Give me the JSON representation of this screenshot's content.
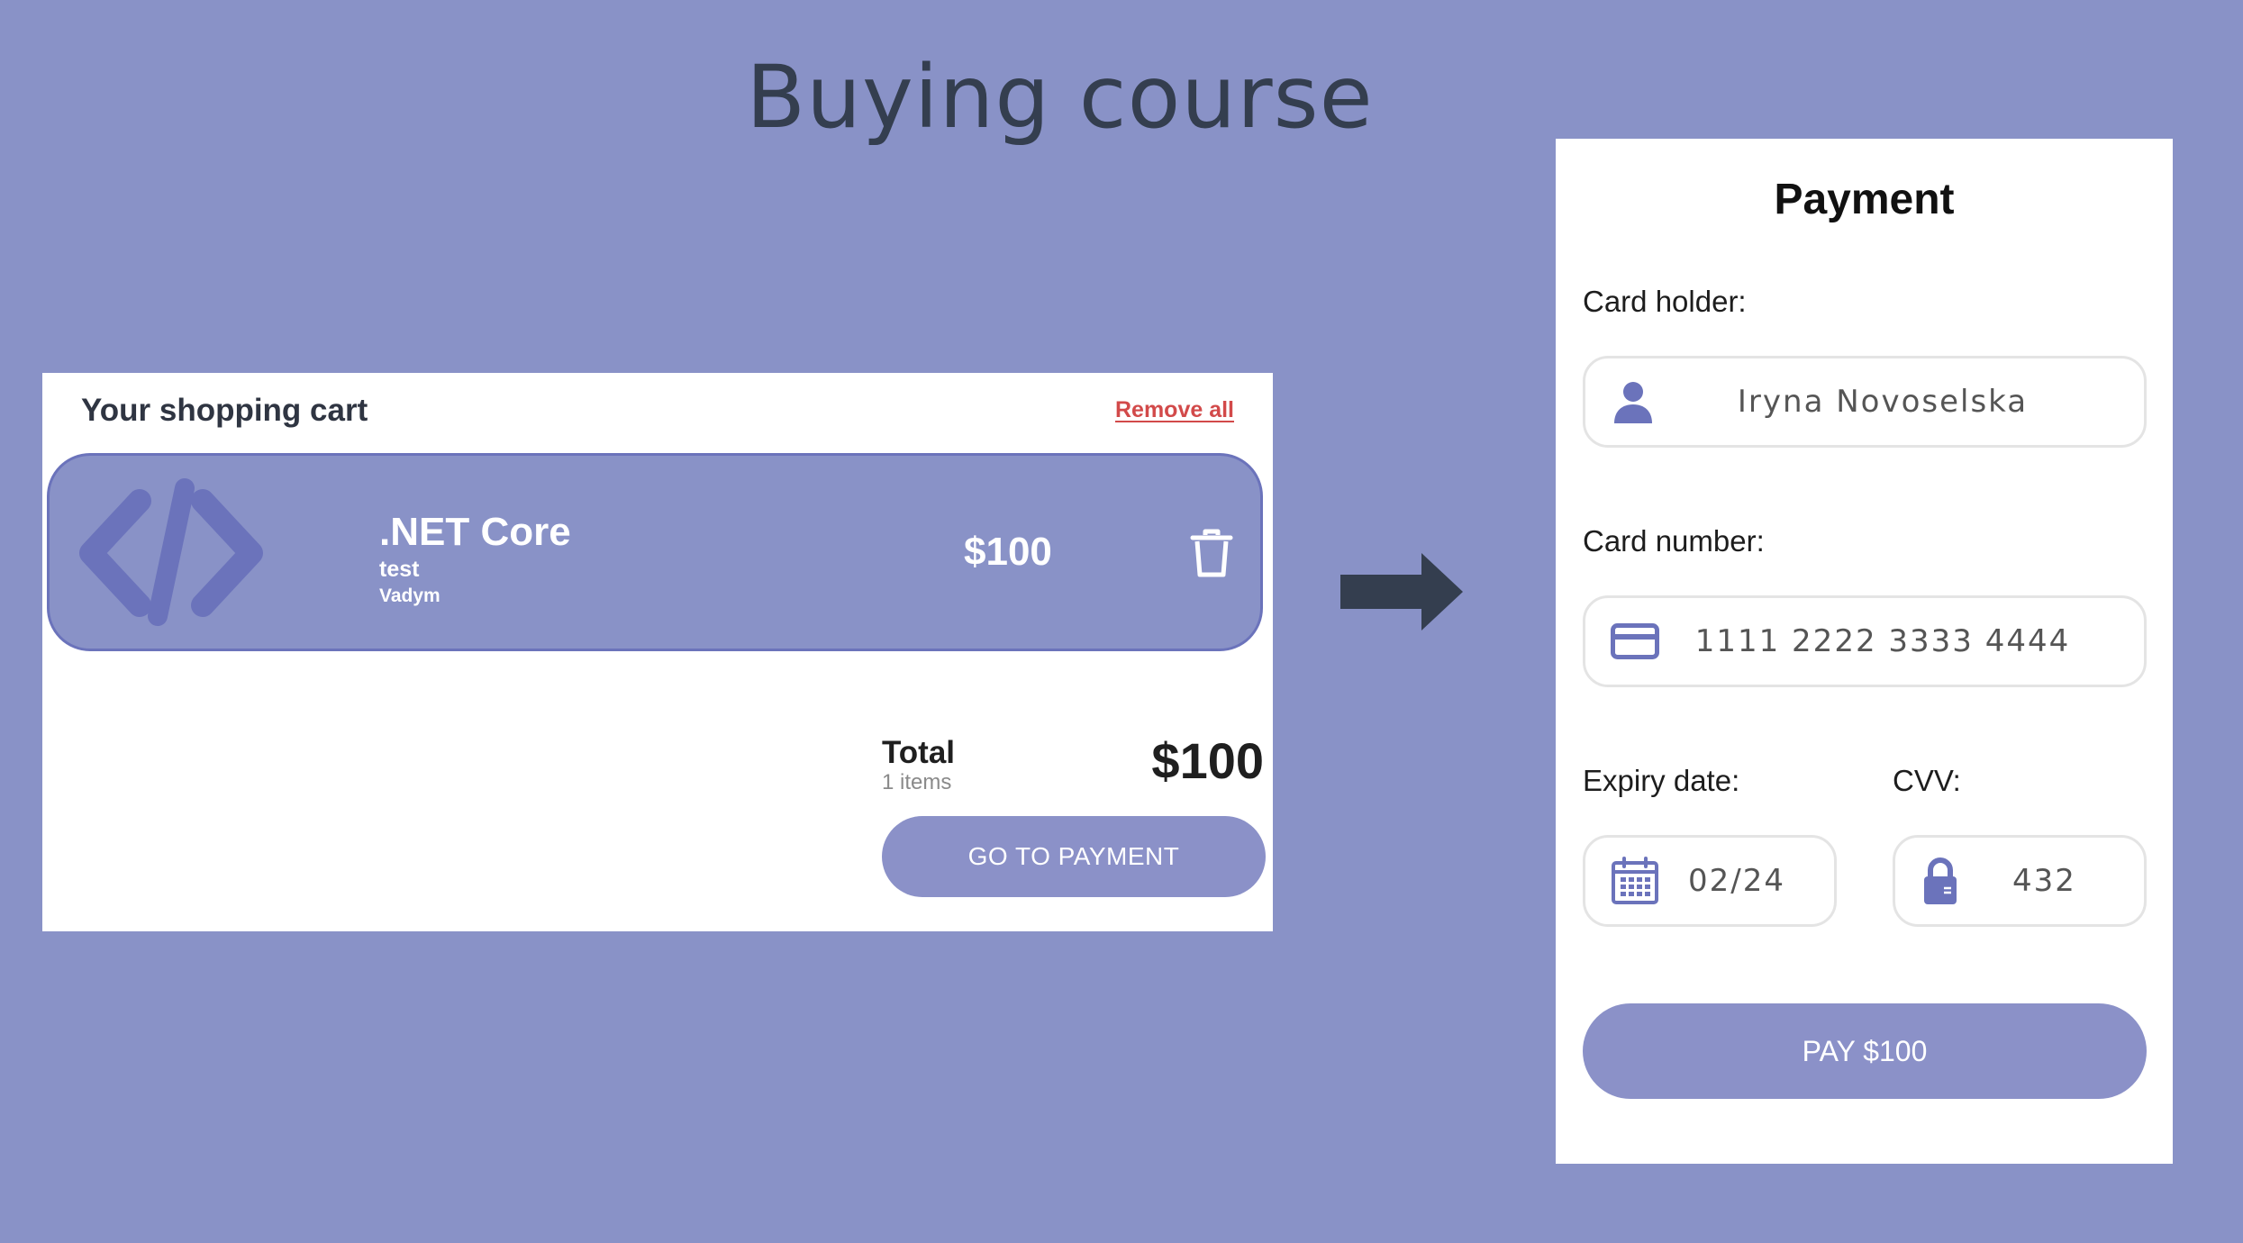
{
  "slide": {
    "title": "Buying course"
  },
  "cart": {
    "heading": "Your shopping cart",
    "remove_all": "Remove all",
    "item": {
      "icon": "code-brackets-icon",
      "title": ".NET Core",
      "subtitle": "test",
      "author": "Vadym",
      "price": "$100",
      "delete_icon": "trash-icon"
    },
    "total_label": "Total",
    "items_count": "1 items",
    "total_amount": "$100",
    "go_to_payment": "GO TO PAYMENT"
  },
  "flow_arrow_icon": "right-arrow-icon",
  "payment": {
    "title": "Payment",
    "card_holder": {
      "label": "Card holder:",
      "value": "Iryna Novoselska",
      "icon": "user-icon"
    },
    "card_number": {
      "label": "Card number:",
      "value": "1111 2222 3333 4444",
      "icon": "credit-card-icon"
    },
    "expiry": {
      "label": "Expiry date:",
      "value": "02/24",
      "icon": "calendar-icon"
    },
    "cvv": {
      "label": "CVV:",
      "value": "432",
      "icon": "lock-icon"
    },
    "pay_button": "PAY $100"
  },
  "colors": {
    "background": "#8992c7",
    "accent": "#8b91c8",
    "icon_accent": "#6b73bb",
    "danger": "#d24a4a",
    "dark": "#343e4f"
  }
}
